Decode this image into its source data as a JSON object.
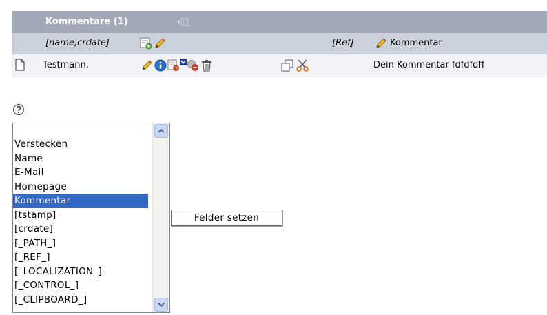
{
  "comments_panel": {
    "title": "Kommentare (1)",
    "columns": {
      "name_crdate": "[name,crdate]",
      "ref": "[Ref]",
      "comment": "Kommentar"
    },
    "row": {
      "name": "Testmann,",
      "comment": "Dein Kommentar fdfdfdff"
    }
  },
  "field_selector": {
    "options": [
      "Verstecken",
      "Name",
      "E-Mail",
      "Homepage",
      "Kommentar",
      "[tstamp]",
      "[crdate]",
      "[_PATH_]",
      "[_REF_]",
      "[_LOCALIZATION_]",
      "[_CONTROL_]",
      "[_CLIPBOARD_]"
    ],
    "selected": "Kommentar",
    "button_label": "Felder setzen"
  },
  "colors": {
    "header_bg": "#a2aab8",
    "column_row_bg": "#cbd1db",
    "selection": "#3168c6"
  }
}
